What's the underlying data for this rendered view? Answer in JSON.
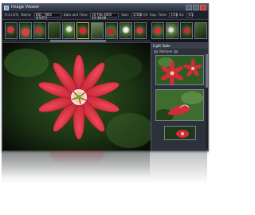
{
  "window": {
    "title": "Image Viewer"
  },
  "toolbar": {
    "zoom_label": "R:3:(1/5)",
    "name_label": "Name:",
    "name_value": "DSC_7061 (15/17)",
    "date_label": "Date and Time:",
    "date_value": "10 Feb 2005  15:38:08",
    "size_label": "Size:",
    "size_value": "1/100",
    "aperture_label": "f/4",
    "exposure_label": "Exp. Time:",
    "exposure_value": "1/10",
    "ev_label": "Ev:",
    "ev_value": "4.5"
  },
  "light_table": {
    "title": "Light Table",
    "remove_label": "Remove"
  },
  "colors": {
    "window_bg": "#2a2e36",
    "title_bar": "#3a4152",
    "flower_red": "#d42b3a",
    "leaf_green": "#2f5a22"
  }
}
